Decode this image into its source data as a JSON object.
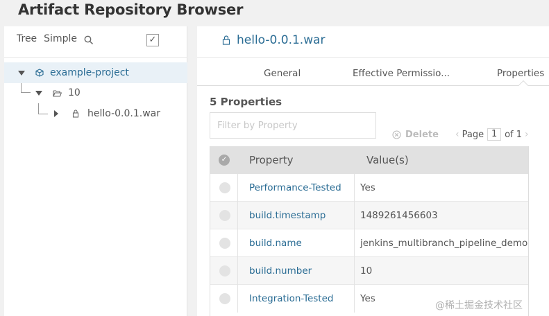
{
  "page": {
    "title": "Artifact Repository Browser"
  },
  "tree_toolbar": {
    "tree_label": "Tree",
    "simple_label": "Simple",
    "check_mark": "✓"
  },
  "tree": {
    "project": "example-project",
    "folder": "10",
    "file": "hello-0.0.1.war"
  },
  "detail": {
    "file_name": "hello-0.0.1.war",
    "tabs": [
      "General",
      "Effective Permissio...",
      "Properties"
    ],
    "active_tab": "Properties",
    "count_label": "5 Properties",
    "filter_placeholder": "Filter by Property",
    "delete_label": "Delete",
    "pager": {
      "page_label": "Page",
      "page": "1",
      "of_label": "of 1"
    },
    "table": {
      "headers": [
        "Property",
        "Value(s)"
      ],
      "rows": [
        {
          "key": "Performance-Tested",
          "value": "Yes"
        },
        {
          "key": "build.timestamp",
          "value": "1489261456603"
        },
        {
          "key": "build.name",
          "value": "jenkins_multibranch_pipeline_demo"
        },
        {
          "key": "build.number",
          "value": "10"
        },
        {
          "key": "Integration-Tested",
          "value": "Yes"
        }
      ]
    }
  },
  "watermark": "@稀土掘金技术社区",
  "colors": {
    "link": "#2a6c94",
    "selected_row": "#e9f1f7",
    "header_bg": "#e1e1e1"
  }
}
